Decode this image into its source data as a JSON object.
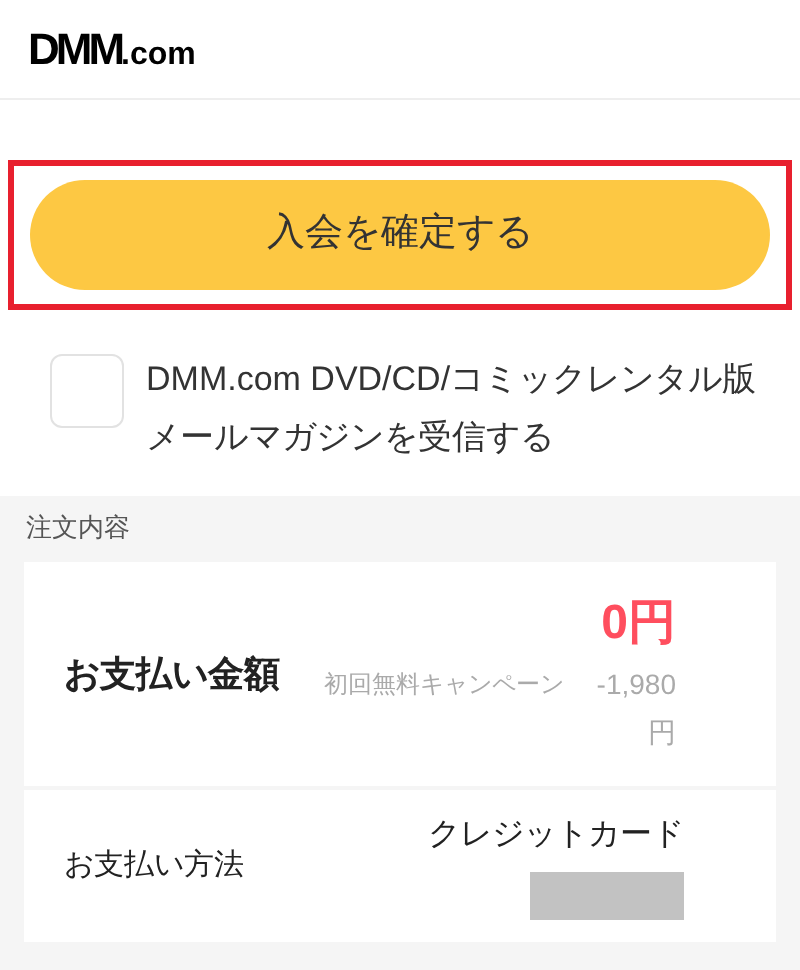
{
  "header": {
    "logo_mark": "DMM",
    "logo_suffix": ".com"
  },
  "confirm_button": {
    "label": "入会を確定する",
    "highlighted": true
  },
  "newsletter": {
    "label": "DMM.com DVD/CD/コミックレンタル版メールマガジンを受信する",
    "checked": false
  },
  "order": {
    "heading": "注文内容",
    "amount": {
      "label": "お支払い金額",
      "price": "0円",
      "campaign": "初回無料キャンペーン",
      "discount": "-1,980円"
    },
    "method": {
      "label": "お支払い方法",
      "value": "クレジットカード",
      "redacted": true
    }
  }
}
